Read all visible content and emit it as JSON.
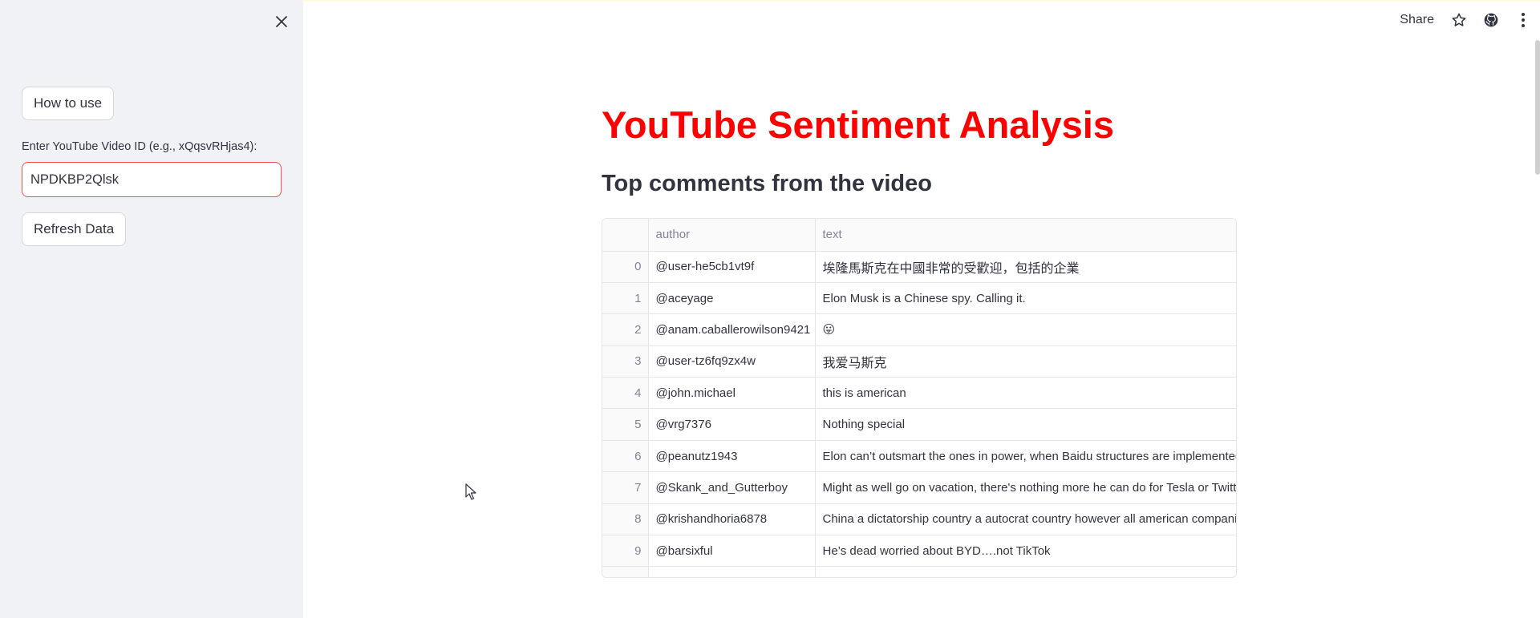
{
  "sidebar": {
    "close_icon": "close-icon",
    "how_to_use_label": "How to use",
    "video_id_label": "Enter YouTube Video ID (e.g., xQqsvRHjas4):",
    "video_id_value": "NPDKBP2Qlsk",
    "refresh_label": "Refresh Data"
  },
  "toolbar": {
    "share_label": "Share",
    "icons": [
      "star-icon",
      "github-icon",
      "more-vertical-icon"
    ]
  },
  "main": {
    "title": "YouTube Sentiment Analysis",
    "title_color": "#ff0000",
    "subtitle": "Top comments from the video"
  },
  "table": {
    "columns": [
      "",
      "author",
      "text"
    ],
    "rows": [
      {
        "index": "0",
        "author": "@user-he5cb1vt9f",
        "text": "埃隆馬斯克在中國非常的受歡迎，包括的企業"
      },
      {
        "index": "1",
        "author": "@aceyage",
        "text": "Elon Musk is a Chinese spy. Calling it."
      },
      {
        "index": "2",
        "author": "@anam.caballerowilson9421",
        "text": "😛"
      },
      {
        "index": "3",
        "author": "@user-tz6fq9zx4w",
        "text": "我爱马斯克"
      },
      {
        "index": "4",
        "author": "@john.michael",
        "text": "this is american"
      },
      {
        "index": "5",
        "author": "@vrg7376",
        "text": "Nothing special"
      },
      {
        "index": "6",
        "author": "@peanutz1943",
        "text": "Elon can’t outsmart the ones in power, when Baidu structures are implemented"
      },
      {
        "index": "7",
        "author": "@Skank_and_Gutterboy",
        "text": "Might as well go on vacation, there's nothing more he can do for Tesla or Twitter"
      },
      {
        "index": "8",
        "author": "@krishandhoria6878",
        "text": "China a dictatorship country a autocrat country however all american companies"
      },
      {
        "index": "9",
        "author": "@barsixful",
        "text": "He’s dead worried about BYD….not TikTok"
      }
    ]
  },
  "colors": {
    "accent": "#ff4b4b",
    "sidebar_bg": "#f0f2f6"
  }
}
